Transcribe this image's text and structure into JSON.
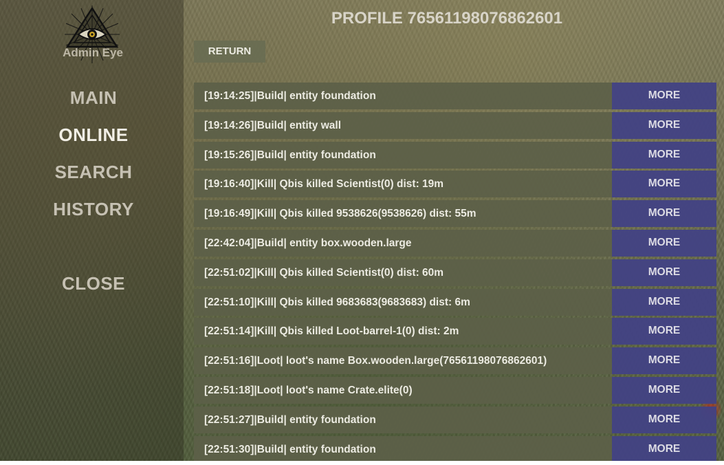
{
  "brand": {
    "name": "Admin Eye"
  },
  "sidebar": {
    "items": [
      {
        "label": "MAIN"
      },
      {
        "label": "ONLINE"
      },
      {
        "label": "SEARCH"
      },
      {
        "label": "HISTORY"
      },
      {
        "label": "CLOSE"
      }
    ],
    "active": "ONLINE"
  },
  "header": {
    "title": "PROFILE 76561198076862601",
    "return_label": "RETURN"
  },
  "log": {
    "more_label": "MORE",
    "rows": [
      {
        "text": "[19:14:25]|Build| entity foundation"
      },
      {
        "text": "[19:14:26]|Build| entity wall"
      },
      {
        "text": "[19:15:26]|Build| entity foundation"
      },
      {
        "text": "[19:16:40]|Kill| Qbis killed Scientist(0) dist: 19m"
      },
      {
        "text": "[19:16:49]|Kill| Qbis killed 9538626(9538626) dist: 55m"
      },
      {
        "text": "[22:42:04]|Build| entity box.wooden.large"
      },
      {
        "text": "[22:51:02]|Kill| Qbis killed Scientist(0) dist: 60m"
      },
      {
        "text": "[22:51:10]|Kill| Qbis killed 9683683(9683683) dist: 6m"
      },
      {
        "text": "[22:51:14]|Kill| Qbis killed Loot-barrel-1(0) dist: 2m"
      },
      {
        "text": "[22:51:16]|Loot| loot's name Box.wooden.large(76561198076862601)"
      },
      {
        "text": "[22:51:18]|Loot| loot's name Crate.elite(0)"
      },
      {
        "text": "[22:51:27]|Build| entity foundation"
      },
      {
        "text": "[22:51:30]|Build| entity foundation"
      }
    ]
  },
  "colors": {
    "more_button": "#434383",
    "row_background": "#5d6048",
    "text_light": "#ecebe2"
  }
}
